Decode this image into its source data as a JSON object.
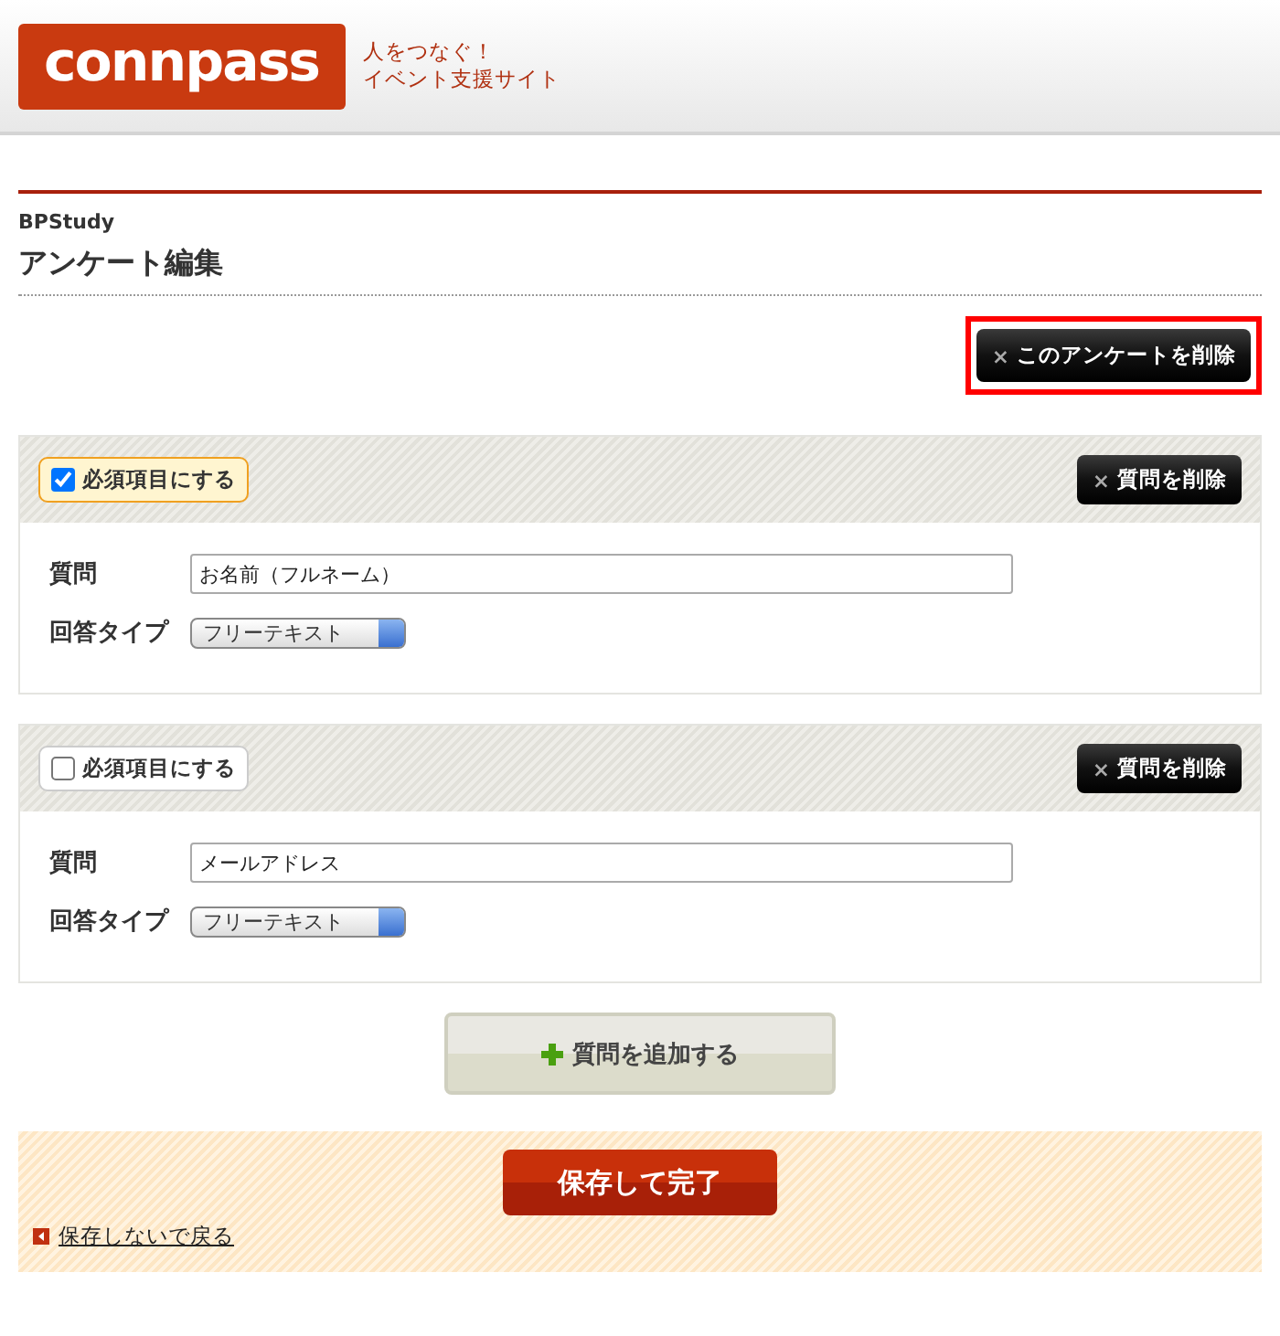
{
  "header": {
    "logo": "connpass",
    "tagline": [
      "人をつなぐ！",
      "イベント支援サイト"
    ]
  },
  "group": "BPStudy",
  "title": "アンケート編集",
  "delete_survey": {
    "icon": "×",
    "label": "このアンケートを削除",
    "highlighted": true
  },
  "questions": [
    {
      "required": {
        "label": "必須項目にする",
        "checked": true
      },
      "delete": {
        "icon": "×",
        "label": "質問を削除"
      },
      "question_label": "質問",
      "question_value": "お名前（フルネーム）",
      "type_label": "回答タイプ",
      "type_value": "フリーテキスト"
    },
    {
      "required": {
        "label": "必須項目にする",
        "checked": false
      },
      "delete": {
        "icon": "×",
        "label": "質問を削除"
      },
      "question_label": "質問",
      "question_value": "メールアドレス",
      "type_label": "回答タイプ",
      "type_value": "フリーテキスト"
    }
  ],
  "add_question": "質問を追加する",
  "save": "保存して完了",
  "back_link": "保存しないで戻る"
}
